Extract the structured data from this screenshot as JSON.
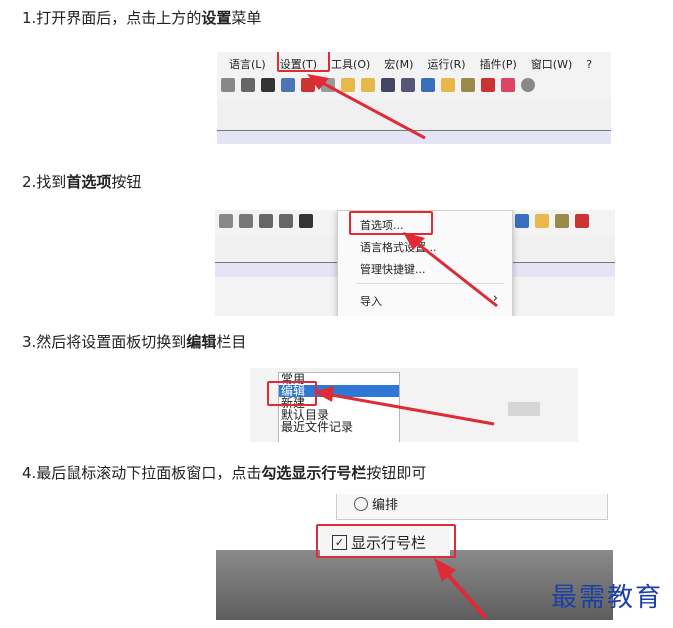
{
  "steps": [
    {
      "pre": "1.打开界面后，点击上方的",
      "bold": "设置",
      "post": "菜单"
    },
    {
      "pre": "2.找到",
      "bold": "首选项",
      "post": "按钮"
    },
    {
      "pre": "3.然后将设置面板切换到",
      "bold": "编辑",
      "post": "栏目"
    },
    {
      "pre": "4.最后鼠标滚动下拉面板窗口，点击",
      "bold": "勾选显示行号栏",
      "post": "按钮即可"
    }
  ],
  "menubar": {
    "items": [
      "语言(L)",
      "设置(T)",
      "工具(O)",
      "宏(M)",
      "运行(R)",
      "插件(P)",
      "窗口(W)",
      "?"
    ]
  },
  "dropdown": {
    "items": [
      "首选项...",
      "语言格式设置...",
      "管理快捷键...",
      "导入"
    ],
    "submenu_arrow": "›"
  },
  "settings_list": {
    "items": [
      "常用",
      "编辑",
      "新建",
      "默认目录",
      "最近文件记录"
    ],
    "selected": "编辑"
  },
  "step4_panel": {
    "radio_label": "编排",
    "checkbox_label": "显示行号栏",
    "checked": true
  },
  "watermark": "最需教育",
  "colors": {
    "highlight_red": "#e02a35",
    "selection_blue": "#2f78d6",
    "lavender_bar": "#e4e4f4",
    "watermark_blue": "#1c3fa8"
  }
}
